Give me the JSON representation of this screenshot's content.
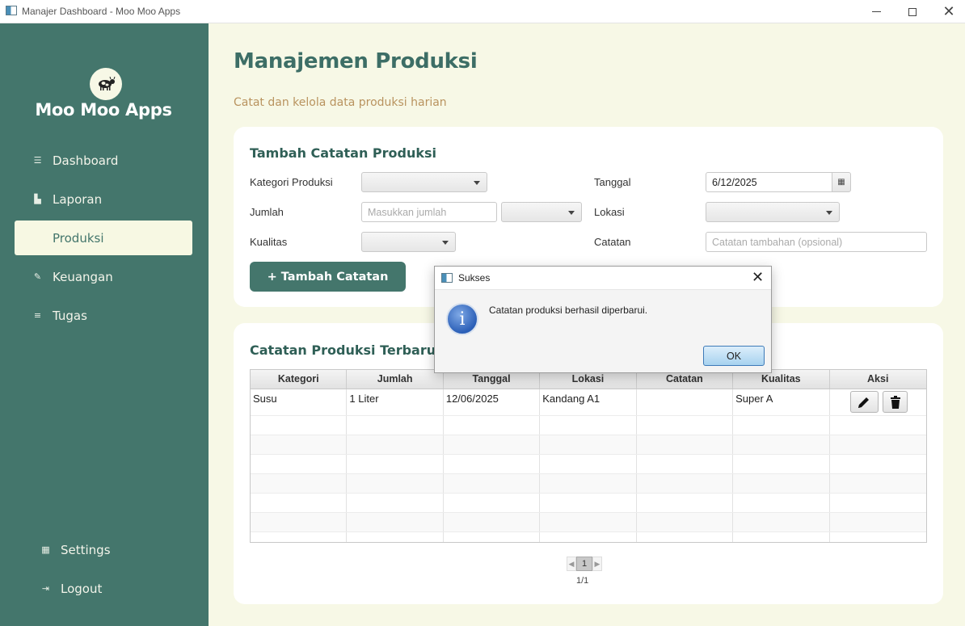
{
  "window": {
    "title": "Manajer Dashboard - Moo Moo Apps"
  },
  "sidebar": {
    "brand": "Moo Moo Apps",
    "items": [
      {
        "label": "Dashboard",
        "icon": "dashboard-icon"
      },
      {
        "label": "Laporan",
        "icon": "chart-icon"
      },
      {
        "label": "Produksi",
        "icon": "",
        "active": true
      },
      {
        "label": "Keuangan",
        "icon": "money-icon"
      },
      {
        "label": "Tugas",
        "icon": "tasks-icon"
      }
    ],
    "bottom": [
      {
        "label": "Settings",
        "icon": "settings-icon"
      },
      {
        "label": "Logout",
        "icon": "logout-icon"
      }
    ]
  },
  "main": {
    "title": "Manajemen Produksi",
    "subtitle": "Catat dan kelola data produksi harian"
  },
  "form": {
    "title": "Tambah Catatan Produksi",
    "kategori_label": "Kategori Produksi",
    "jumlah_label": "Jumlah",
    "jumlah_placeholder": "Masukkan jumlah",
    "kualitas_label": "Kualitas",
    "tanggal_label": "Tanggal",
    "tanggal_value": "6/12/2025",
    "lokasi_label": "Lokasi",
    "catatan_label": "Catatan",
    "catatan_placeholder": "Catatan tambahan (opsional)",
    "add_button": "+ Tambah Catatan"
  },
  "records": {
    "title": "Catatan Produksi Terbaru",
    "columns": [
      "Kategori",
      "Jumlah",
      "Tanggal",
      "Lokasi",
      "Catatan",
      "Kualitas",
      "Aksi"
    ],
    "rows": [
      {
        "kategori": "Susu",
        "jumlah": "1 Liter",
        "tanggal": "12/06/2025",
        "lokasi": "Kandang A1",
        "catatan": "",
        "kualitas": "Super A"
      }
    ],
    "pagination": {
      "current": "1",
      "info": "1/1"
    }
  },
  "dialog": {
    "title": "Sukses",
    "message": "Catatan produksi berhasil diperbarui.",
    "ok": "OK"
  },
  "colors": {
    "sidebar": "#44766c",
    "background": "#f7f8e6",
    "title": "#3d6e66",
    "subtitle": "#b9935f",
    "active_item": "#f7f8e3"
  }
}
